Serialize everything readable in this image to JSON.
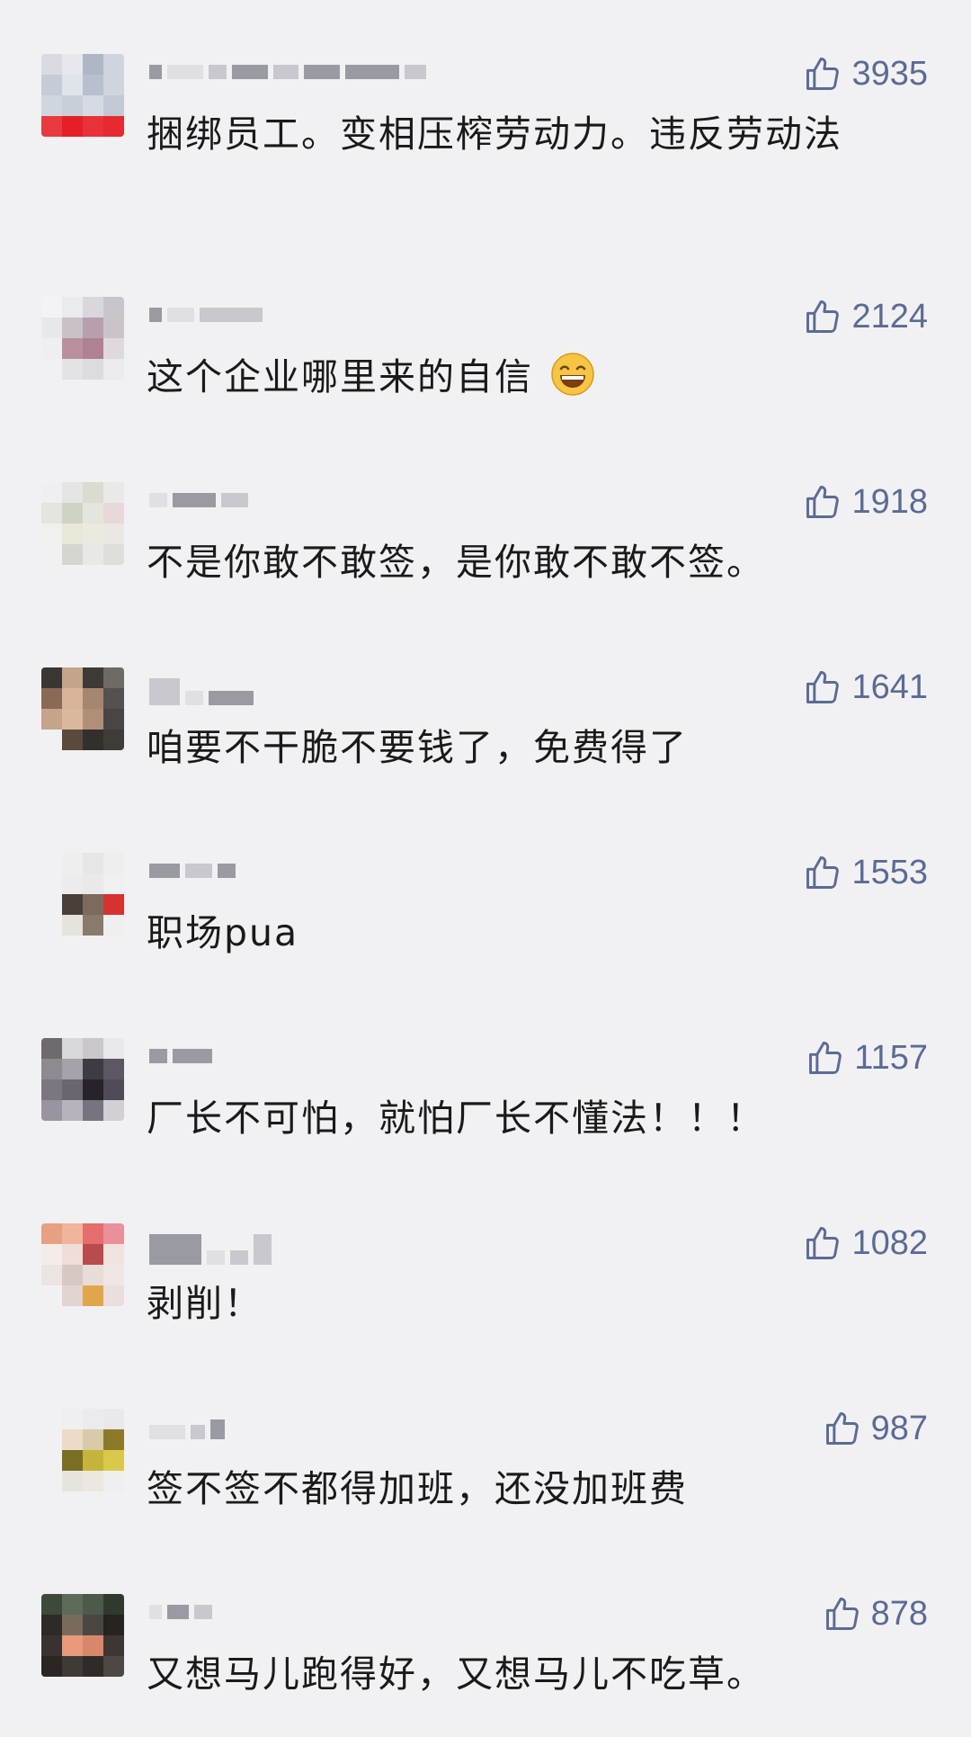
{
  "comments": [
    {
      "likes": "3935",
      "text": "捆绑员工。变相压榨劳动力。违反劳动法"
    },
    {
      "likes": "2124",
      "text": "这个企业哪里来的自信",
      "emoji": "grinning-face-emoji"
    },
    {
      "likes": "1918",
      "text": "不是你敢不敢签，是你敢不敢不签。"
    },
    {
      "likes": "1641",
      "text": "咱要不干脆不要钱了，免费得了"
    },
    {
      "likes": "1553",
      "text": "职场pua"
    },
    {
      "likes": "1157",
      "text": "厂长不可怕，就怕厂长不懂法！！！"
    },
    {
      "likes": "1082",
      "text": "剥削！"
    },
    {
      "likes": "987",
      "text": "签不签不都得加班，还没加班费"
    },
    {
      "likes": "878",
      "text": "又想马儿跑得好，又想马儿不吃草。"
    }
  ],
  "icons": {
    "like": "thumbs-up-icon",
    "avatar": "blurred-avatar"
  },
  "colors": {
    "background": "#f1f1f3",
    "like_count": "#5b6b94",
    "comment_text": "#1a1a1a"
  }
}
